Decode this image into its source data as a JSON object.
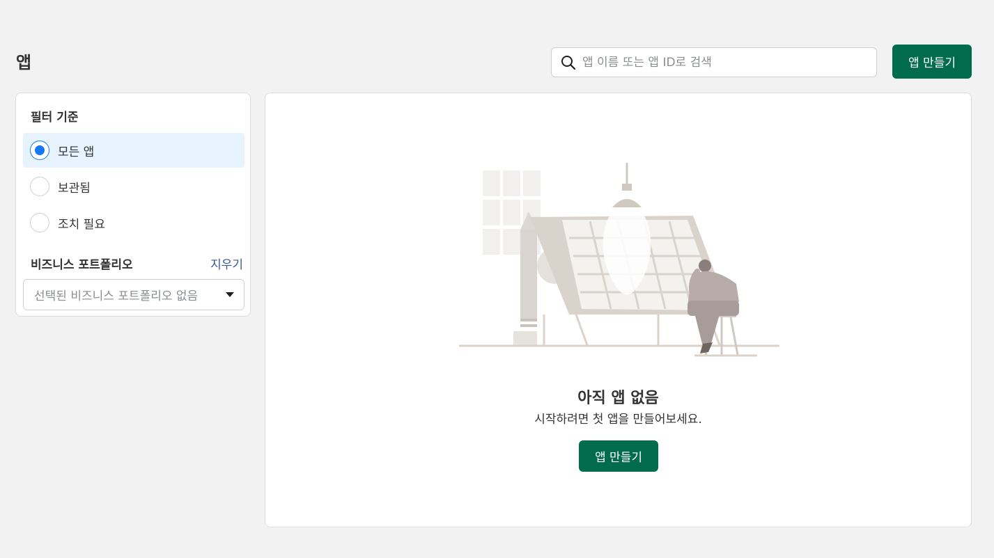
{
  "page": {
    "title": "앱"
  },
  "search": {
    "placeholder": "앱 이름 또는 앱 ID로 검색",
    "value": ""
  },
  "header": {
    "create_button_label": "앱 만들기"
  },
  "filter": {
    "heading": "필터 기준",
    "options": [
      {
        "label": "모든 앱",
        "selected": true
      },
      {
        "label": "보관됨",
        "selected": false
      },
      {
        "label": "조치 필요",
        "selected": false
      }
    ],
    "portfolio_heading": "비즈니스 포트폴리오",
    "clear_label": "지우기",
    "portfolio_select_value": "선택된 비즈니스 포트폴리오 없음"
  },
  "empty_state": {
    "illustration": "person-at-drafting-table-illustration",
    "title": "아직 앱 없음",
    "subtitle": "시작하려면 첫 앱을 만들어보세요.",
    "button_label": "앱 만들기"
  },
  "colors": {
    "background": "#f2f2f2",
    "primary_button": "#006b4d",
    "selected_row": "#e7f3ff",
    "radio_selected": "#1877f2",
    "link": "#385898"
  },
  "icons": {
    "search": "search-icon",
    "dropdown": "caret-down-icon"
  }
}
